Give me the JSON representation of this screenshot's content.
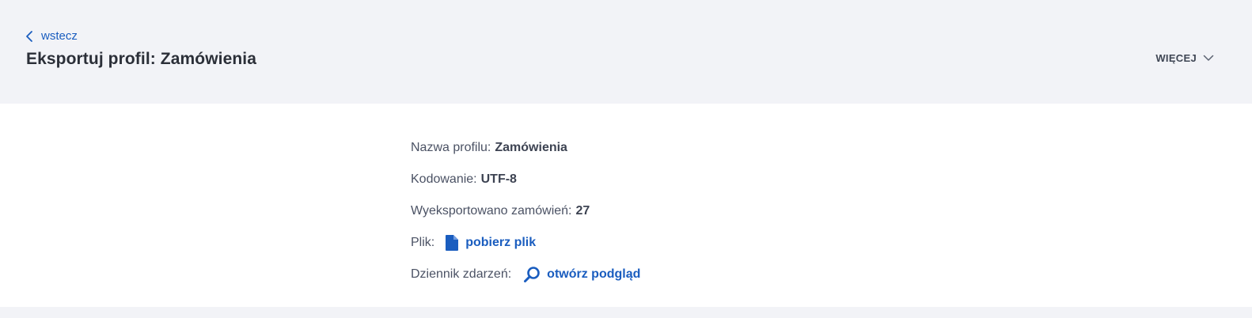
{
  "header": {
    "back_label": "wstecz",
    "title": "Eksportuj profil: Zamówienia",
    "more_label": "WIĘCEJ"
  },
  "details": {
    "profile_name_label": "Nazwa profilu:",
    "profile_name_value": "Zamówienia",
    "encoding_label": "Kodowanie:",
    "encoding_value": "UTF-8",
    "exported_label": "Wyeksportowano zamówień:",
    "exported_value": "27",
    "file_label": "Plik:",
    "file_link": "pobierz plik",
    "log_label": "Dziennik zdarzeń:",
    "log_link": "otwórz podgląd"
  },
  "icons": {
    "back": "chevron-left-icon",
    "more": "chevron-down-icon",
    "file": "document-icon",
    "log": "magnifier-icon"
  },
  "colors": {
    "accent": "#1a5dbf",
    "header_bg": "#f2f3f7",
    "panel_bg": "#ffffff"
  }
}
